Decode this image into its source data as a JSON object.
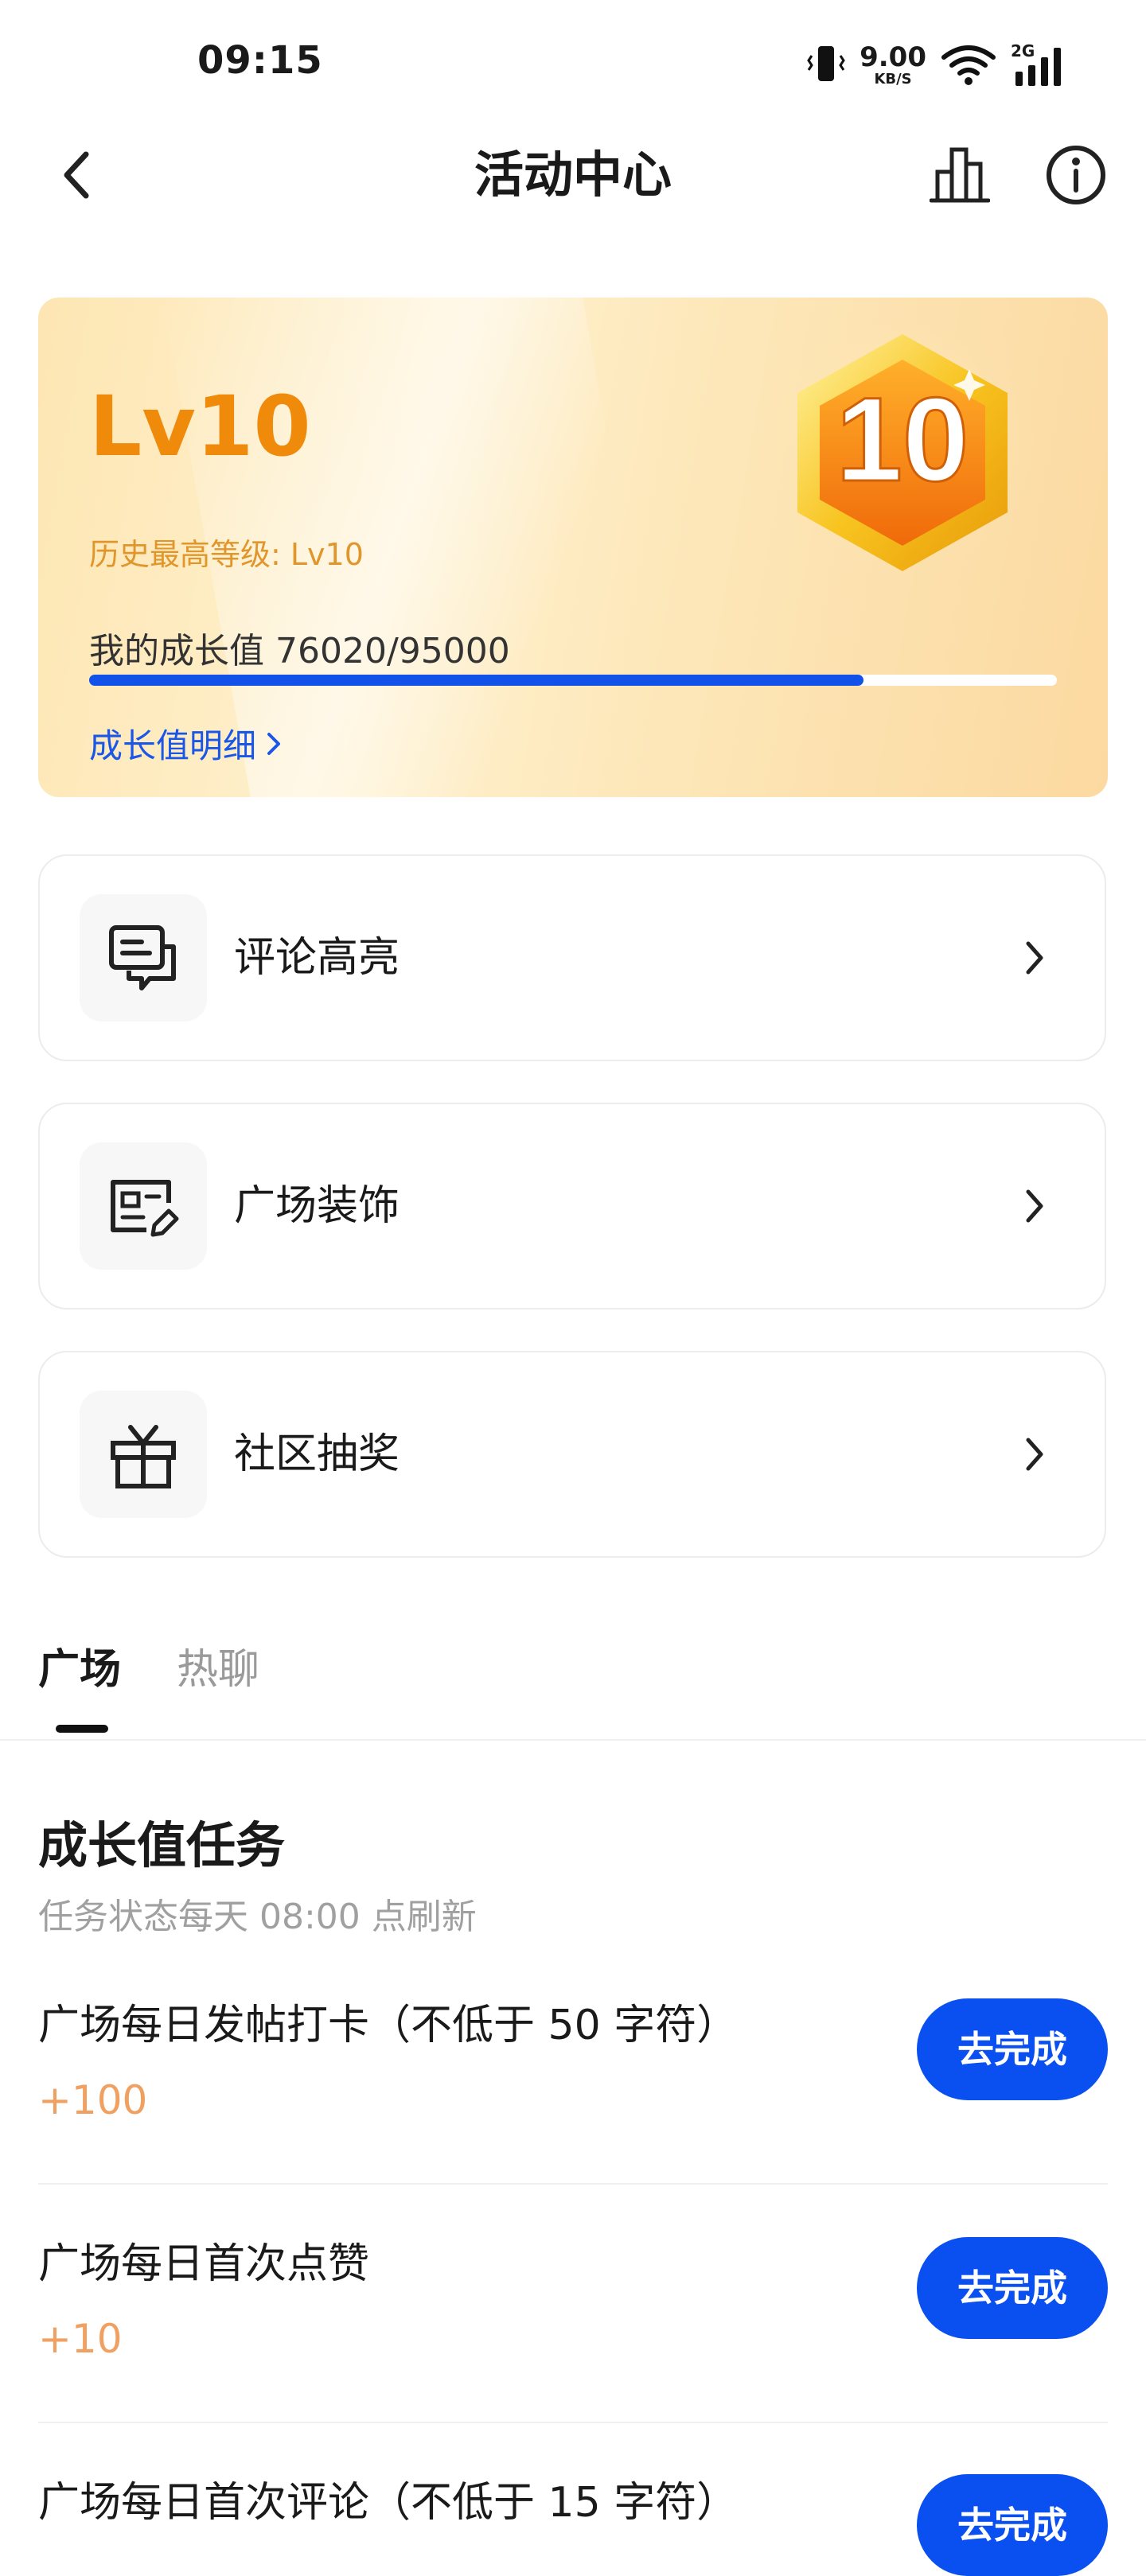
{
  "status_bar": {
    "time": "09:15",
    "net_speed_value": "9.00",
    "net_speed_unit": "KB/S",
    "network_type": "2G",
    "icons": [
      "vibrate-icon",
      "wifi-icon",
      "signal-icon"
    ]
  },
  "nav": {
    "title": "活动中心",
    "back_icon": "back-arrow-icon",
    "ranking_icon": "bar-chart-icon",
    "info_icon": "info-icon"
  },
  "level_card": {
    "level": "Lv10",
    "history_best": "历史最高等级: Lv10",
    "growth_text": "我的成长值 76020/95000",
    "growth_current": 76020,
    "growth_max": 95000,
    "detail_link": "成长值明细",
    "badge_number": "10",
    "colors": {
      "level": "#f08a0a",
      "progress": "#1352e8",
      "link": "#1a57e8"
    }
  },
  "menu": [
    {
      "label": "评论高亮",
      "icon": "comment-highlight-icon"
    },
    {
      "label": "广场装饰",
      "icon": "profile-edit-icon"
    },
    {
      "label": "社区抽奖",
      "icon": "gift-icon"
    }
  ],
  "tabs": {
    "active": "广场",
    "inactive": "热聊"
  },
  "tasks": {
    "title": "成长值任务",
    "subtitle": "任务状态每天 08:00 点刷新",
    "button_color": "#0a4ff0",
    "items": [
      {
        "name": "广场每日发帖打卡（不低于 50 字符）",
        "points": "+100",
        "button": "去完成"
      },
      {
        "name": "广场每日首次点赞",
        "points": "+10",
        "button": "去完成"
      },
      {
        "name": "广场每日首次评论（不低于 15 字符）",
        "points": "",
        "button": "去完成"
      }
    ]
  }
}
